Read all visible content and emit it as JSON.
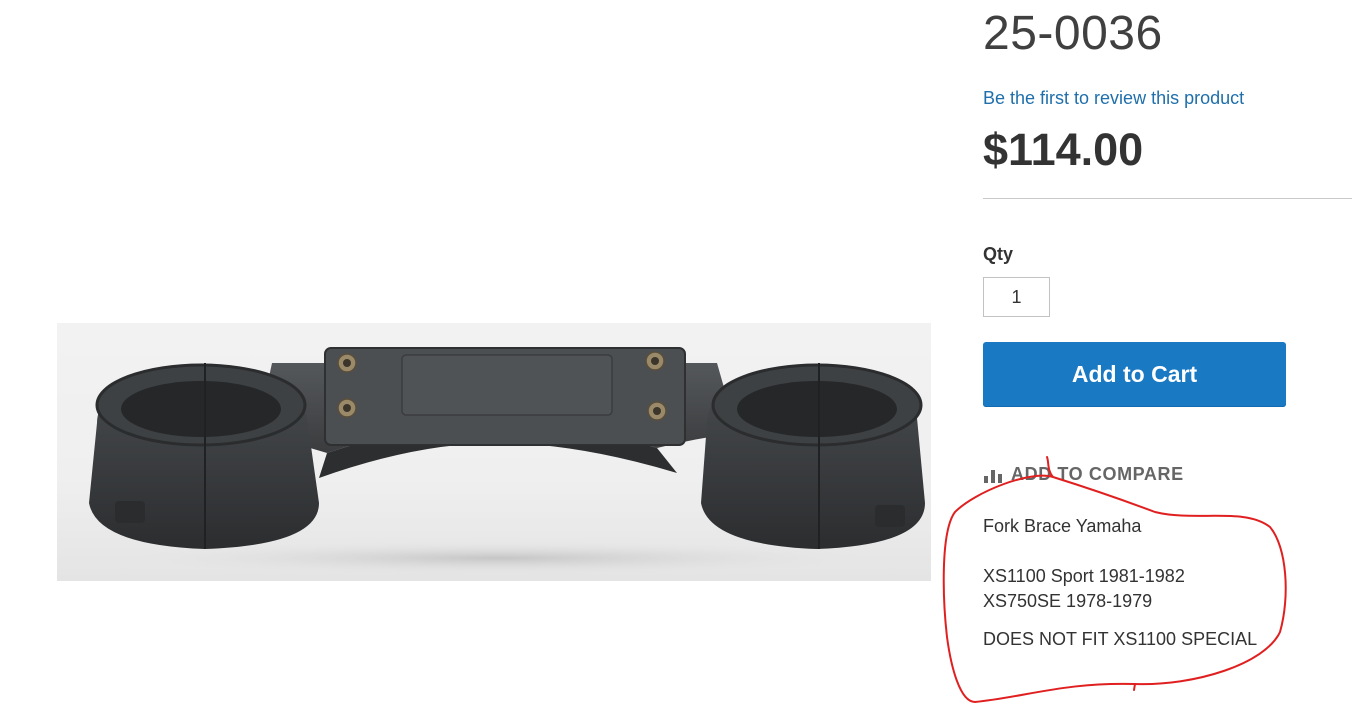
{
  "product": {
    "sku": "25-0036",
    "review_link": "Be the first to review this product",
    "price": "$114.00",
    "qty_label": "Qty",
    "qty_value": "1",
    "add_to_cart_label": "Add to Cart",
    "compare_label": "ADD TO COMPARE",
    "compare_icon": "bar-chart-icon"
  },
  "description": {
    "line1": "Fork Brace Yamaha",
    "line2": "XS1100 Sport 1981-1982",
    "line3": "XS750SE 1978-1979",
    "line4": "DOES NOT FIT XS1100 SPECIAL"
  },
  "colors": {
    "accent": "#1979c3",
    "link": "#1f6fab",
    "annotation": "#e02020"
  }
}
